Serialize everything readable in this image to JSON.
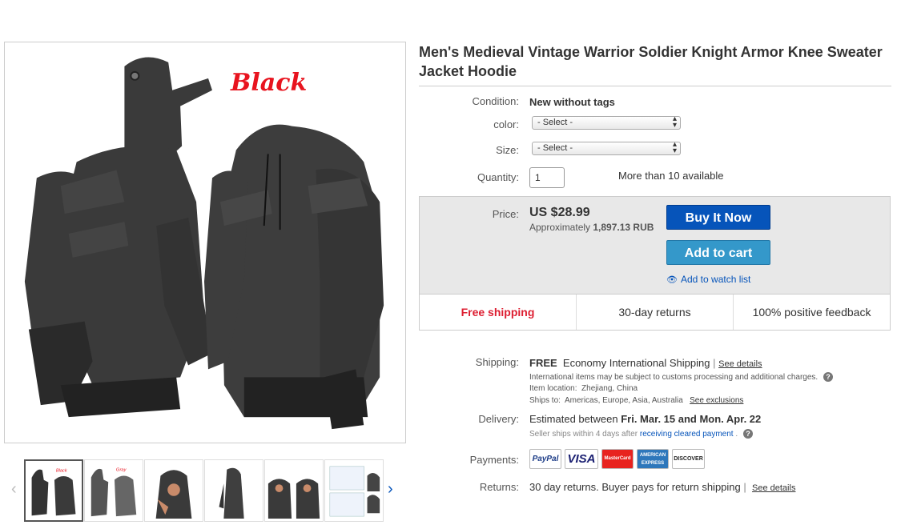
{
  "product": {
    "title": "Men's Medieval Vintage Warrior Soldier Knight Armor Knee Sweater Jacket Hoodie",
    "image_color_tag": "Black"
  },
  "gallery": {
    "thumb_count": 6,
    "selected_index": 0
  },
  "details": {
    "condition_label": "Condition:",
    "condition_value": "New without tags",
    "color_label": "color:",
    "color_select": "- Select -",
    "size_label": "Size:",
    "size_select": "- Select -",
    "quantity_label": "Quantity:",
    "quantity_value": "1",
    "availability": "More than 10 available"
  },
  "price": {
    "label": "Price:",
    "value": "US $28.99",
    "approx_prefix": "Approximately",
    "approx_value": "1,897.13 RUB",
    "buy_now": "Buy It Now",
    "add_to_cart": "Add to cart",
    "watch": "Add to watch list"
  },
  "features": [
    "Free shipping",
    "30-day returns",
    "100% positive feedback"
  ],
  "shipping": {
    "label": "Shipping:",
    "cost": "FREE",
    "method": "Economy International Shipping",
    "see_details": "See details",
    "customs_note": "International items may be subject to customs processing and additional charges.",
    "location_label": "Item location:",
    "location": "Zhejiang, China",
    "ships_to_label": "Ships to:",
    "ships_to": "Americas, Europe, Asia, Australia",
    "see_exclusions": "See exclusions"
  },
  "delivery": {
    "label": "Delivery:",
    "prefix": "Estimated between",
    "range": "Fri. Mar. 15 and Mon. Apr. 22",
    "note_prefix": "Seller ships within 4 days after",
    "note_link": "receiving cleared payment"
  },
  "payments": {
    "label": "Payments:",
    "logos": [
      "PayPal",
      "VISA",
      "MasterCard",
      "AMERICAN EXPRESS",
      "DISCOVER"
    ]
  },
  "returns": {
    "label": "Returns:",
    "text": "30 day returns. Buyer pays for return shipping",
    "see_details": "See details"
  }
}
